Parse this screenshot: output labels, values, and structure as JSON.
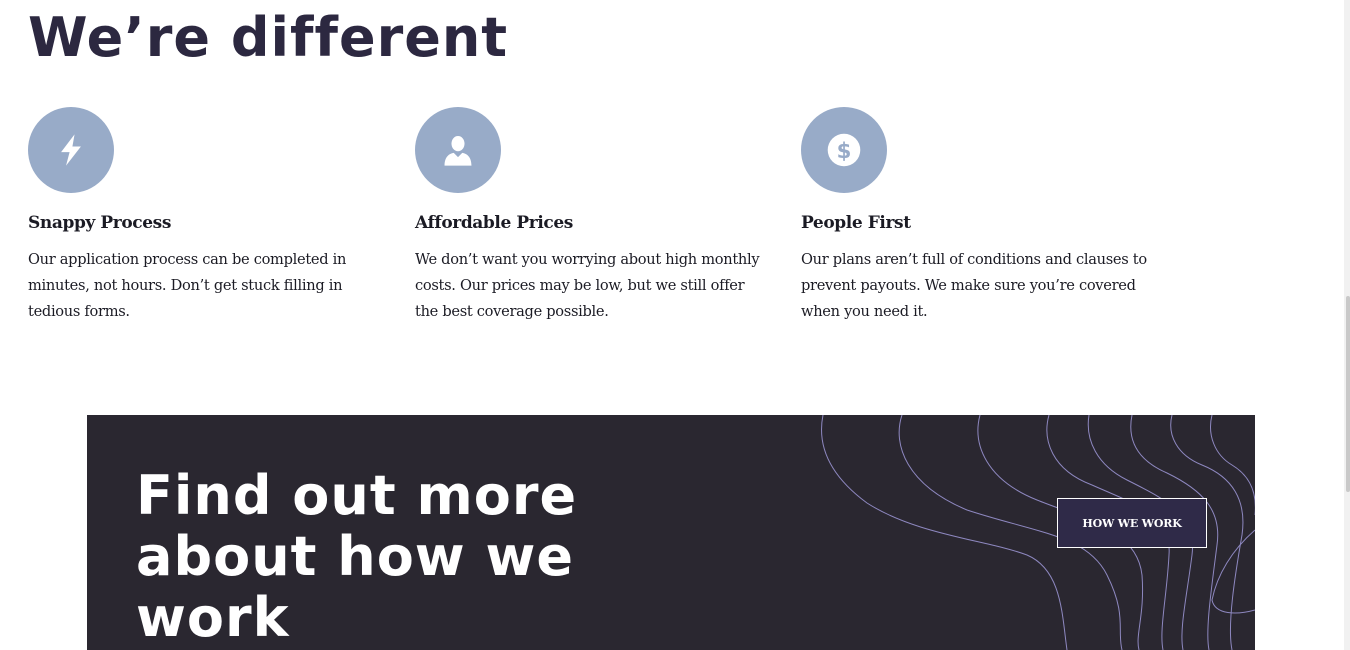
{
  "section": {
    "title": "We’re different"
  },
  "features": [
    {
      "icon": "lightning-icon",
      "title": "Snappy Process",
      "text": "Our application process can be completed in minutes, not hours. Don’t get stuck filling in tedious forms."
    },
    {
      "icon": "user-icon",
      "title": "Affordable Prices",
      "text": "We don’t want you worrying about high monthly costs. Our prices may be low, but we still offer the best coverage possible."
    },
    {
      "icon": "dollar-icon",
      "title": "People First",
      "text": "Our plans aren’t full of conditions and clauses to prevent payouts. We make sure you’re covered when you need it."
    }
  ],
  "cta": {
    "heading": "Find out more about how we work",
    "button_label": "How we work"
  },
  "colors": {
    "heading": "#2c2840",
    "icon_circle": "#98abc8",
    "cta_background": "#2a2730",
    "cta_button": "#2f2a48",
    "cta_lines": "#8e88c0"
  }
}
